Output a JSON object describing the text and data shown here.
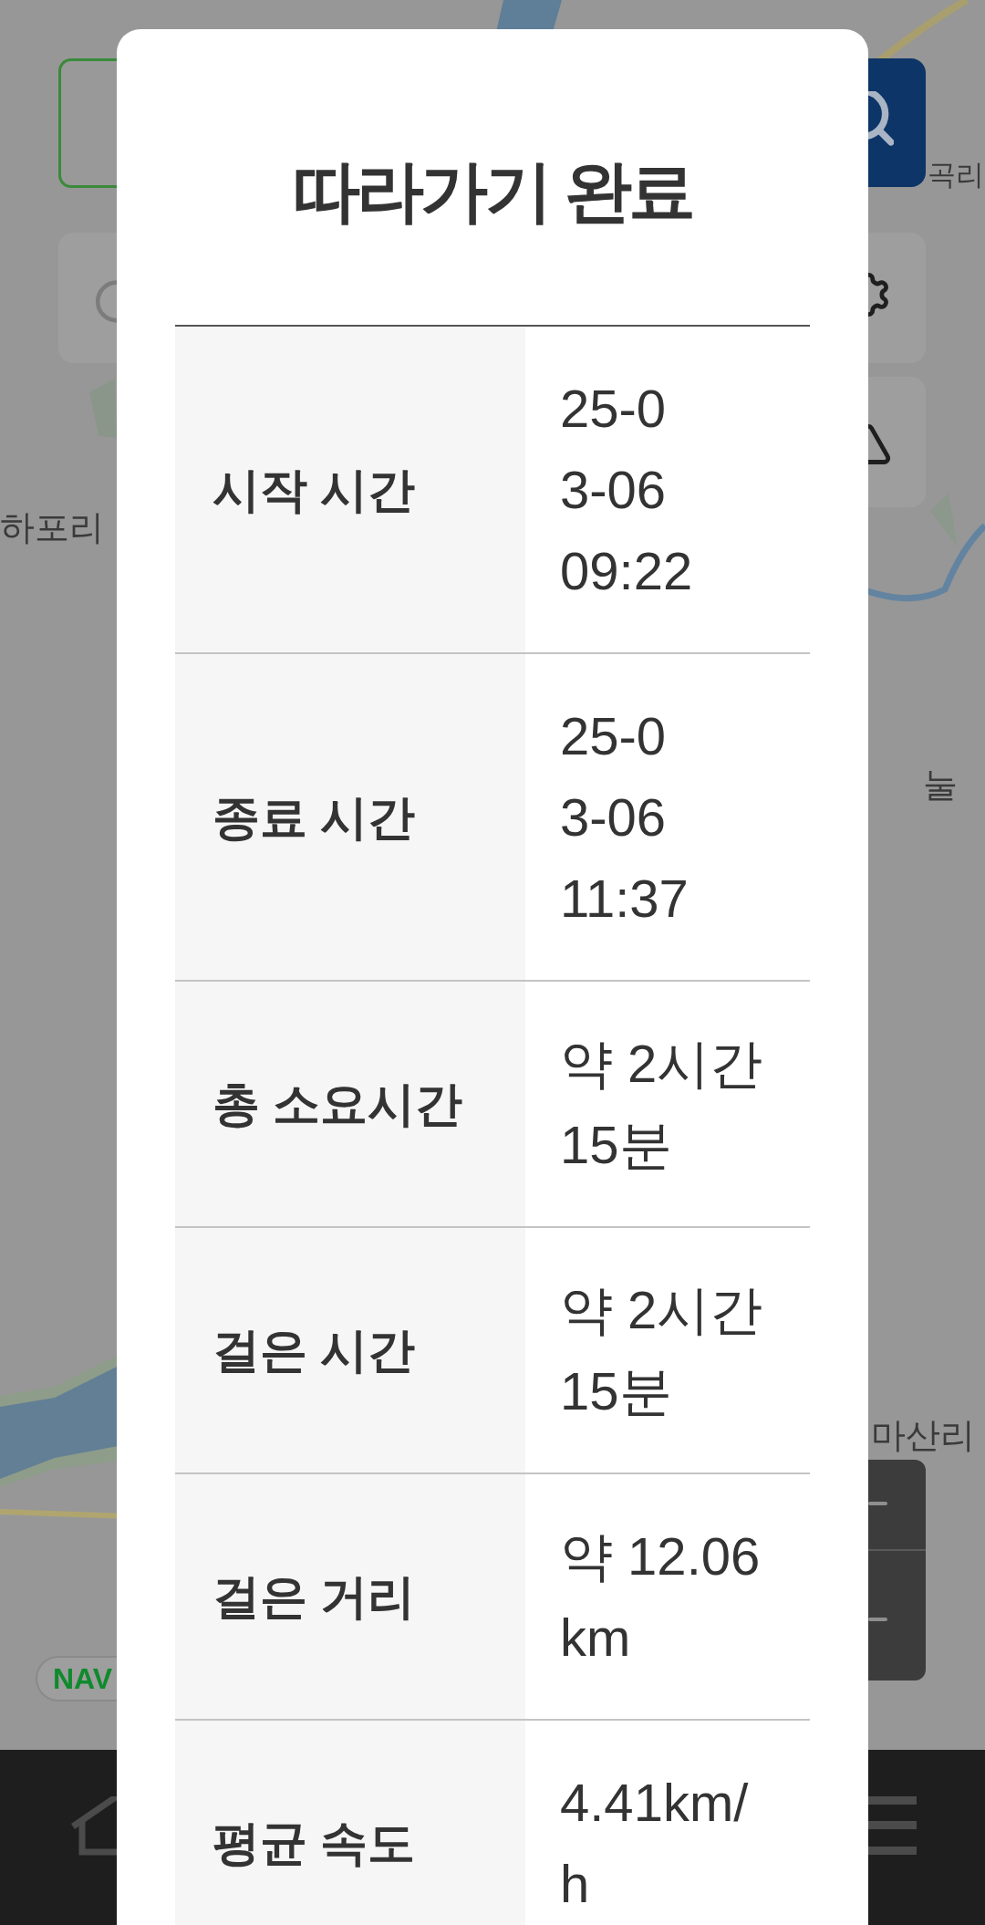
{
  "map_labels": [
    "곡리",
    "하포리",
    "눌",
    "마산리"
  ],
  "map_logo": "NAV",
  "dialog": {
    "title": "따라가기 완료",
    "rows": [
      {
        "label": "시작 시간",
        "value": "25-03-06 09:22",
        "kind": "datetime"
      },
      {
        "label": "종료 시간",
        "value": "25-03-06 11:37",
        "kind": "datetime"
      },
      {
        "label": "총 소요시간",
        "value": "약 2시간 15분",
        "kind": "text"
      },
      {
        "label": "걸은 시간",
        "value": "약 2시간 15분",
        "kind": "text"
      },
      {
        "label": "걸은 거리",
        "value": "약 12.06km",
        "kind": "text"
      },
      {
        "label": "평균 속도",
        "value": "4.41km/h",
        "kind": "text"
      }
    ]
  }
}
